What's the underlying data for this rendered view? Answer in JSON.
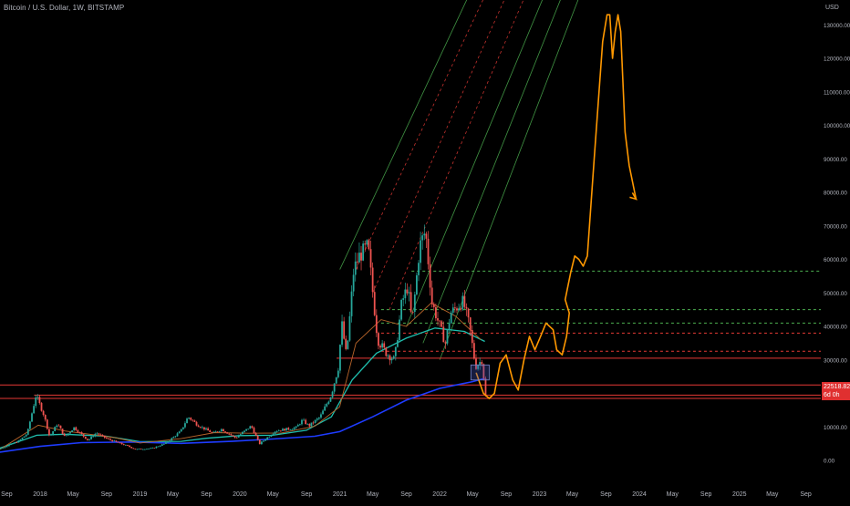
{
  "header": {
    "symbol_line": "Bitcoin / U.S. Dollar, 1W, BITSTAMP"
  },
  "current_price": {
    "value": "22518.82",
    "countdown": "6d 0h",
    "color": "#e03030"
  },
  "colors": {
    "up": "#26a69a",
    "down": "#ef5350",
    "ema_teal": "#1fbfae",
    "sma_blue": "#1e3cff",
    "brown_ma": "#b8642a",
    "orange_path": "#ff9800",
    "green_channel": "#4caf50",
    "red_channel": "#e53935",
    "support_red": "#e53935",
    "box": "#3f51b5"
  },
  "chart_data": {
    "type": "line",
    "title": "Bitcoin / U.S. Dollar, 1W, BITSTAMP",
    "yaxis_label": "USD",
    "ylim": [
      -4000,
      140000
    ],
    "y_ticks": [
      0,
      10000,
      20000,
      30000,
      40000,
      50000,
      60000,
      70000,
      80000,
      90000,
      100000,
      110000,
      120000,
      130000
    ],
    "y_tick_labels": [
      "0.00",
      "10000.00",
      "20000.00",
      "30000.00",
      "40000.00",
      "50000.00",
      "60000.00",
      "70000.00",
      "80000.00",
      "90000.00",
      "100000.00",
      "110000.00",
      "120000.00",
      "130000.00"
    ],
    "x_ticks": [
      "Sep",
      "2018",
      "May",
      "Sep",
      "2019",
      "May",
      "Sep",
      "2020",
      "May",
      "Sep",
      "2021",
      "May",
      "Sep",
      "2022",
      "May",
      "Sep",
      "2023",
      "May",
      "Sep",
      "2024",
      "May",
      "Sep",
      "2025",
      "May",
      "Sep"
    ],
    "x_tick_dates": [
      "2017-09-01",
      "2018-01-01",
      "2018-05-01",
      "2018-09-01",
      "2019-01-01",
      "2019-05-01",
      "2019-09-01",
      "2020-01-01",
      "2020-05-01",
      "2020-09-01",
      "2021-01-01",
      "2021-05-01",
      "2021-09-01",
      "2022-01-01",
      "2022-05-01",
      "2022-09-01",
      "2023-01-01",
      "2023-05-01",
      "2023-09-01",
      "2024-01-01",
      "2024-05-01",
      "2024-09-01",
      "2025-01-01",
      "2025-05-01",
      "2025-09-01"
    ],
    "price_series": {
      "name": "BTCUSD weekly",
      "points": [
        [
          "2017-07-01",
          2500
        ],
        [
          "2017-09-01",
          4300
        ],
        [
          "2017-10-15",
          5800
        ],
        [
          "2017-11-15",
          8000
        ],
        [
          "2017-12-17",
          19500
        ],
        [
          "2018-01-15",
          13500
        ],
        [
          "2018-02-05",
          7000
        ],
        [
          "2018-03-05",
          11000
        ],
        [
          "2018-04-01",
          7000
        ],
        [
          "2018-05-05",
          9800
        ],
        [
          "2018-06-25",
          6000
        ],
        [
          "2018-07-25",
          8200
        ],
        [
          "2018-09-01",
          6500
        ],
        [
          "2018-11-20",
          4200
        ],
        [
          "2018-12-15",
          3300
        ],
        [
          "2019-02-15",
          3600
        ],
        [
          "2019-04-05",
          5100
        ],
        [
          "2019-05-30",
          8700
        ],
        [
          "2019-06-26",
          13000
        ],
        [
          "2019-08-01",
          10500
        ],
        [
          "2019-09-25",
          8100
        ],
        [
          "2019-10-26",
          9300
        ],
        [
          "2019-12-17",
          6700
        ],
        [
          "2020-02-12",
          10300
        ],
        [
          "2020-03-13",
          4900
        ],
        [
          "2020-05-10",
          8800
        ],
        [
          "2020-07-25",
          9800
        ],
        [
          "2020-08-17",
          12000
        ],
        [
          "2020-09-10",
          10300
        ],
        [
          "2020-10-21",
          13000
        ],
        [
          "2020-11-30",
          19500
        ],
        [
          "2020-12-27",
          28000
        ],
        [
          "2021-01-08",
          41000
        ],
        [
          "2021-01-25",
          31000
        ],
        [
          "2021-02-21",
          57000
        ],
        [
          "2021-03-13",
          61000
        ],
        [
          "2021-04-14",
          64000
        ],
        [
          "2021-05-19",
          36000
        ],
        [
          "2021-06-20",
          32000
        ],
        [
          "2021-07-20",
          30000
        ],
        [
          "2021-08-15",
          47000
        ],
        [
          "2021-09-06",
          52000
        ],
        [
          "2021-09-22",
          41000
        ],
        [
          "2021-10-20",
          64000
        ],
        [
          "2021-11-10",
          68500
        ],
        [
          "2021-12-04",
          47000
        ],
        [
          "2022-01-22",
          35000
        ],
        [
          "2022-02-10",
          44000
        ],
        [
          "2022-03-28",
          47500
        ],
        [
          "2022-04-20",
          40000
        ],
        [
          "2022-05-12",
          28000
        ],
        [
          "2022-06-05",
          30000
        ],
        [
          "2022-06-18",
          19000
        ]
      ]
    },
    "ema_series": {
      "name": "EMA (teal)",
      "points": [
        [
          "2017-07-01",
          2600
        ],
        [
          "2017-12-20",
          7500
        ],
        [
          "2018-04-01",
          7800
        ],
        [
          "2018-09-01",
          7200
        ],
        [
          "2019-01-01",
          5600
        ],
        [
          "2019-06-01",
          5700
        ],
        [
          "2019-09-01",
          6600
        ],
        [
          "2020-01-01",
          7400
        ],
        [
          "2020-05-01",
          7500
        ],
        [
          "2020-09-01",
          9000
        ],
        [
          "2020-12-01",
          13000
        ],
        [
          "2021-02-15",
          24000
        ],
        [
          "2021-05-15",
          32000
        ],
        [
          "2021-09-01",
          36500
        ],
        [
          "2021-12-15",
          39500
        ],
        [
          "2022-04-01",
          38500
        ],
        [
          "2022-06-15",
          35500
        ]
      ]
    },
    "sma_series": {
      "name": "SMA (blue)",
      "points": [
        [
          "2017-07-01",
          2000
        ],
        [
          "2018-01-01",
          4200
        ],
        [
          "2018-06-01",
          5300
        ],
        [
          "2018-12-01",
          5500
        ],
        [
          "2019-06-01",
          5100
        ],
        [
          "2019-12-01",
          5700
        ],
        [
          "2020-05-01",
          6400
        ],
        [
          "2020-10-01",
          7200
        ],
        [
          "2021-01-01",
          8600
        ],
        [
          "2021-05-01",
          13000
        ],
        [
          "2021-09-01",
          18000
        ],
        [
          "2022-01-01",
          21500
        ],
        [
          "2022-05-01",
          23500
        ],
        [
          "2022-06-15",
          24500
        ]
      ]
    },
    "brown_ma_series": {
      "name": "MA (brown)",
      "points": [
        [
          "2017-08-01",
          3000
        ],
        [
          "2017-12-25",
          10500
        ],
        [
          "2018-04-01",
          8800
        ],
        [
          "2018-10-01",
          6800
        ],
        [
          "2019-01-01",
          5200
        ],
        [
          "2019-06-01",
          6500
        ],
        [
          "2019-10-01",
          8300
        ],
        [
          "2020-02-01",
          8100
        ],
        [
          "2020-06-01",
          8200
        ],
        [
          "2020-10-01",
          10200
        ],
        [
          "2020-12-31",
          16000
        ],
        [
          "2021-03-01",
          35000
        ],
        [
          "2021-06-01",
          42000
        ],
        [
          "2021-09-01",
          40000
        ],
        [
          "2021-12-01",
          47000
        ],
        [
          "2022-03-01",
          43000
        ],
        [
          "2022-06-01",
          36000
        ]
      ]
    },
    "projection_path": {
      "name": "Projection (orange)",
      "points": [
        [
          "2022-05-15",
          26000
        ],
        [
          "2022-06-10",
          20000
        ],
        [
          "2022-07-01",
          18500
        ],
        [
          "2022-07-20",
          20000
        ],
        [
          "2022-08-10",
          29000
        ],
        [
          "2022-09-01",
          31500
        ],
        [
          "2022-09-25",
          24000
        ],
        [
          "2022-10-15",
          21000
        ],
        [
          "2022-11-05",
          30000
        ],
        [
          "2022-11-25",
          37000
        ],
        [
          "2022-12-15",
          33000
        ],
        [
          "2023-01-05",
          37000
        ],
        [
          "2023-01-25",
          41000
        ],
        [
          "2023-02-20",
          39000
        ],
        [
          "2023-03-05",
          33000
        ],
        [
          "2023-03-25",
          31500
        ],
        [
          "2023-04-10",
          37000
        ],
        [
          "2023-04-20",
          44000
        ],
        [
          "2023-04-05",
          48000
        ],
        [
          "2023-04-25",
          56000
        ],
        [
          "2023-05-10",
          61000
        ],
        [
          "2023-05-25",
          60000
        ],
        [
          "2023-06-10",
          58000
        ],
        [
          "2023-06-25",
          61000
        ],
        [
          "2023-07-20",
          90000
        ],
        [
          "2023-08-20",
          125000
        ],
        [
          "2023-09-05",
          133000
        ],
        [
          "2023-09-15",
          133000
        ],
        [
          "2023-09-25",
          120000
        ],
        [
          "2023-10-05",
          128000
        ],
        [
          "2023-10-15",
          133000
        ],
        [
          "2023-10-25",
          128000
        ],
        [
          "2023-11-10",
          98000
        ],
        [
          "2023-11-25",
          88000
        ],
        [
          "2023-12-20",
          78000
        ]
      ]
    },
    "horizontal_levels": [
      {
        "name": "support-upper",
        "y": 22518.82,
        "color": "#e53935",
        "style": "solid"
      },
      {
        "name": "support-lower",
        "y": 18500,
        "color": "#e53935",
        "style": "solid"
      },
      {
        "name": "support-2017-top",
        "y": 19500,
        "color": "#e53935",
        "style": "solid",
        "from": "2017-12-10"
      },
      {
        "name": "level-30k",
        "y": 30500,
        "color": "#e53935",
        "style": "solid",
        "from": "2020-12-20"
      },
      {
        "name": "level-32k",
        "y": 32600,
        "color": "#e53935",
        "style": "dashed",
        "from": "2021-06-01"
      },
      {
        "name": "level-38k",
        "y": 38000,
        "color": "#e53935",
        "style": "dashed",
        "from": "2021-06-01"
      },
      {
        "name": "level-41k",
        "y": 41000,
        "color": "#4caf50",
        "style": "dashed",
        "from": "2021-06-01"
      },
      {
        "name": "level-45k",
        "y": 45000,
        "color": "#4caf50",
        "style": "dashed",
        "from": "2021-06-01"
      },
      {
        "name": "level-57k",
        "y": 56500,
        "color": "#4caf50",
        "style": "dashed",
        "from": "2021-09-20"
      }
    ],
    "channel_lines": [
      {
        "from": [
          "2021-01-01",
          57000
        ],
        "to": [
          "2023-07-01",
          215000
        ],
        "color": "#4caf50",
        "style": "solid"
      },
      {
        "from": [
          "2021-03-01",
          57000
        ],
        "to": [
          "2023-08-01",
          210000
        ],
        "color": "#e53935",
        "style": "dashed"
      },
      {
        "from": [
          "2021-05-01",
          50000
        ],
        "to": [
          "2023-09-01",
          205000
        ],
        "color": "#e53935",
        "style": "dashed"
      },
      {
        "from": [
          "2021-07-01",
          45000
        ],
        "to": [
          "2023-10-01",
          200000
        ],
        "color": "#e53935",
        "style": "dashed"
      },
      {
        "from": [
          "2021-09-01",
          40000
        ],
        "to": [
          "2023-11-01",
          195000
        ],
        "color": "#4caf50",
        "style": "solid"
      },
      {
        "from": [
          "2021-11-01",
          35000
        ],
        "to": [
          "2023-12-01",
          190000
        ],
        "color": "#4caf50",
        "style": "solid"
      },
      {
        "from": [
          "2022-01-01",
          30000
        ],
        "to": [
          "2024-01-01",
          185000
        ],
        "color": "#4caf50",
        "style": "solid"
      }
    ],
    "zone_box": {
      "from": "2022-04-25",
      "to": "2022-07-01",
      "ylow": 24000,
      "yhigh": 28500,
      "color": "#3f51b5"
    },
    "grid": false
  }
}
